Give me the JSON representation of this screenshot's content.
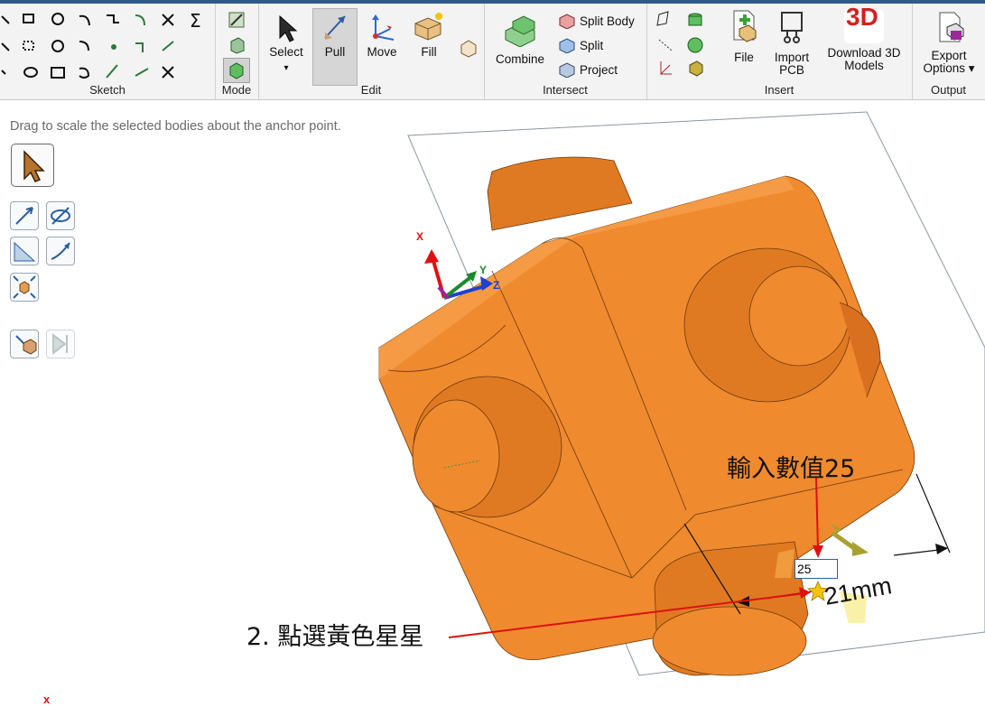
{
  "ribbon": {
    "groups": {
      "sketch": "Sketch",
      "mode": "Mode",
      "edit": "Edit",
      "intersect": "Intersect",
      "insert": "Insert",
      "output": "Output"
    },
    "sketch_sigma": "Σ",
    "edit": {
      "select": "Select",
      "select_arrow": "▾",
      "pull": "Pull",
      "move": "Move",
      "fill": "Fill"
    },
    "intersect": {
      "combine": "Combine",
      "split_body": "Split Body",
      "split": "Split",
      "project": "Project"
    },
    "insert": {
      "file": "File",
      "import_pcb_1": "Import",
      "import_pcb_2": "PCB",
      "download_1": "Download 3D",
      "download_2": "Models",
      "download_badge": "3D"
    },
    "output": {
      "export_1": "Export",
      "export_2": "Options ▾"
    }
  },
  "hint_text": "Drag to scale the selected bodies about the anchor point.",
  "viewport": {
    "axis_x": "X",
    "axis_y": "Y",
    "axis_z": "Z",
    "dimension_value": "25",
    "dimension_suffix": "21mm",
    "corner_marker": "x"
  },
  "annotations": {
    "enter_value": "輸入數值25",
    "click_star": "2. 點選黃色星星"
  },
  "colors": {
    "body": "#f08a2e",
    "body_dark": "#d97020",
    "arrow_red": "#e01010",
    "ribbon_bg": "#f3f3f3"
  }
}
